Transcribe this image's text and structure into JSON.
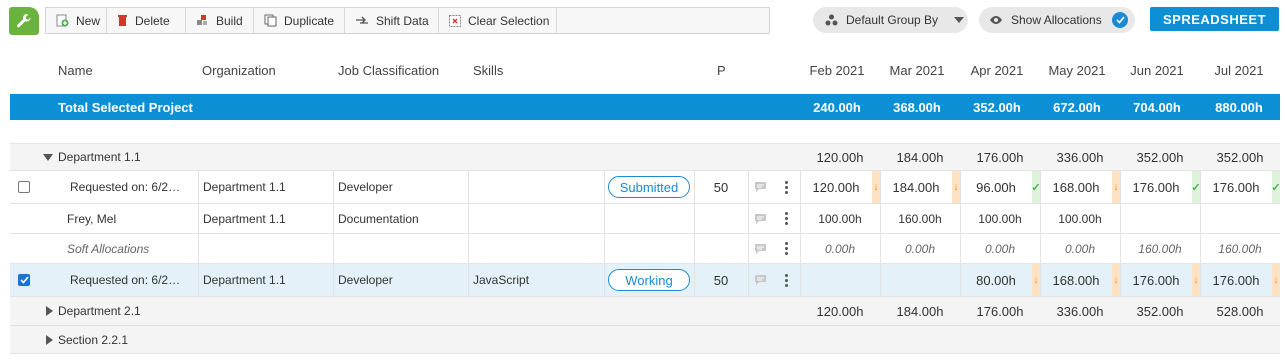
{
  "toolbar": {
    "new": "New",
    "delete": "Delete",
    "build": "Build",
    "duplicate": "Duplicate",
    "shift_data": "Shift Data",
    "clear_selection": "Clear Selection"
  },
  "controls": {
    "group_by": "Default Group By",
    "show_allocations": "Show Allocations",
    "spreadsheet": "SPREADSHEET"
  },
  "colors": {
    "accent": "#0d8fd6",
    "logo": "#6bb33f",
    "warning": "#f0901c",
    "ok": "#4caf50"
  },
  "columns": {
    "name": "Name",
    "organization": "Organization",
    "job_classification": "Job Classification",
    "skills": "Skills",
    "p": "P",
    "months": [
      "Feb 2021",
      "Mar 2021",
      "Apr 2021",
      "May 2021",
      "Jun 2021",
      "Jul 2021"
    ]
  },
  "total": {
    "label": "Total Selected Project",
    "values": [
      "240.00h",
      "368.00h",
      "352.00h",
      "672.00h",
      "704.00h",
      "880.00h"
    ]
  },
  "rows": {
    "dept1": {
      "label": "Department 1.1",
      "values": [
        "120.00h",
        "184.00h",
        "176.00h",
        "336.00h",
        "352.00h",
        "352.00h"
      ]
    },
    "req1": {
      "name": "Requested on: 6/2…",
      "org": "Department 1.1",
      "job": "Developer",
      "skills": "",
      "status": "Submitted",
      "p": "50",
      "values": [
        "120.00h",
        "184.00h",
        "96.00h",
        "168.00h",
        "176.00h",
        "176.00h"
      ],
      "indicators": [
        "down",
        "down",
        "ok",
        "down",
        "ok",
        "ok"
      ]
    },
    "fray": {
      "name": "Frey, Mel",
      "org": "Department 1.1",
      "job": "Documentation",
      "values": [
        "100.00h",
        "160.00h",
        "100.00h",
        "100.00h",
        "",
        ""
      ]
    },
    "soft": {
      "name": "Soft Allocations",
      "values": [
        "0.00h",
        "0.00h",
        "0.00h",
        "0.00h",
        "160.00h",
        "160.00h"
      ]
    },
    "req2": {
      "name": "Requested on: 6/2…",
      "org": "Department 1.1",
      "job": "Developer",
      "skills": "JavaScript",
      "status": "Working",
      "p": "50",
      "values": [
        "",
        "",
        "80.00h",
        "168.00h",
        "176.00h",
        "176.00h"
      ],
      "indicators": [
        "",
        "",
        "down",
        "down",
        "down",
        "down"
      ]
    },
    "dept2": {
      "label": "Department 2.1",
      "values": [
        "120.00h",
        "184.00h",
        "176.00h",
        "336.00h",
        "352.00h",
        "528.00h"
      ]
    },
    "section": {
      "label": "Section 2.2.1"
    }
  }
}
